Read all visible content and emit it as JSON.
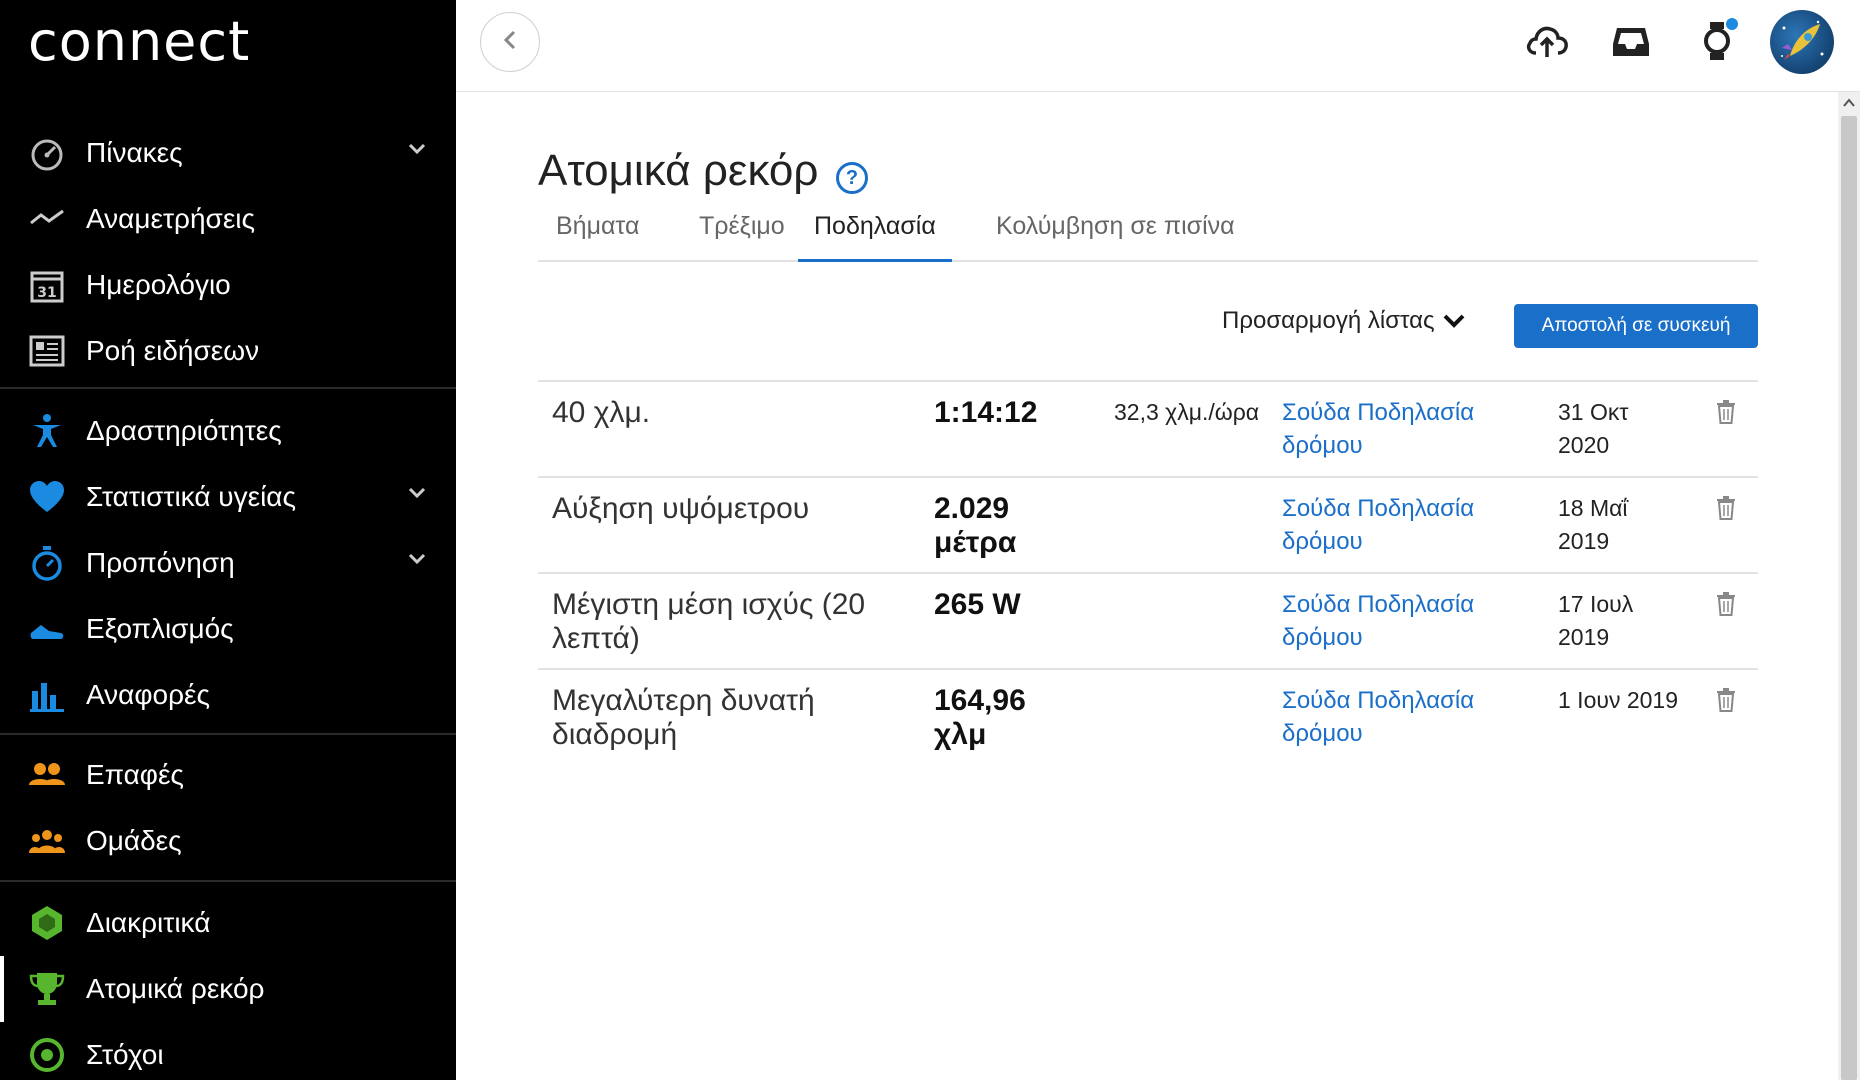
{
  "app": {
    "logo": "connect"
  },
  "sidebar": {
    "items": [
      {
        "label": "Πίνακες",
        "icon": "dashboard-gauge-icon",
        "has_chevron": true
      },
      {
        "label": "Αναμετρήσεις",
        "icon": "trend-icon",
        "has_chevron": false
      },
      {
        "label": "Ημερολόγιο",
        "icon": "calendar-icon",
        "calendar_day": "31",
        "has_chevron": false
      },
      {
        "label": "Ροή ειδήσεων",
        "icon": "newsfeed-icon",
        "has_chevron": false
      },
      {
        "label": "Δραστηριότητες",
        "icon": "activity-person-icon",
        "has_chevron": false
      },
      {
        "label": "Στατιστικά υγείας",
        "icon": "heart-icon",
        "has_chevron": true
      },
      {
        "label": "Προπόνηση",
        "icon": "stopwatch-icon",
        "has_chevron": true
      },
      {
        "label": "Εξοπλισμός",
        "icon": "shoe-icon",
        "has_chevron": false
      },
      {
        "label": "Αναφορές",
        "icon": "bar-chart-icon",
        "has_chevron": false
      },
      {
        "label": "Επαφές",
        "icon": "contacts-icon",
        "has_chevron": false
      },
      {
        "label": "Ομάδες",
        "icon": "groups-icon",
        "has_chevron": false
      },
      {
        "label": "Διακριτικά",
        "icon": "badge-hexagon-icon",
        "has_chevron": false
      },
      {
        "label": "Ατομικά ρεκόρ",
        "icon": "trophy-icon",
        "has_chevron": false,
        "active": true
      },
      {
        "label": "Στόχοι",
        "icon": "target-icon",
        "has_chevron": false
      }
    ]
  },
  "header": {
    "icons": [
      "upload-cloud-icon",
      "inbox-icon",
      "watch-icon",
      "avatar"
    ]
  },
  "page": {
    "title": "Ατομικά ρεκόρ",
    "help": "?",
    "tabs": [
      {
        "label": "Βήματα"
      },
      {
        "label": "Τρέξιμο"
      },
      {
        "label": "Ποδηλασία",
        "active": true
      },
      {
        "label": "Κολύμβηση σε πισίνα"
      }
    ],
    "customize_label": "Προσαρμογή λίστας",
    "send_button": "Αποστολή σε συσκευή"
  },
  "records": [
    {
      "name": "40 χλμ.",
      "value": "1:14:12",
      "speed": "32,3 χλμ./ώρα",
      "activity": "Σούδα Ποδηλασία δρόμου",
      "date": "31 Οκτ 2020"
    },
    {
      "name": "Αύξηση υψόμετρου",
      "value": "2.029 μέτρα",
      "speed": "",
      "activity": "Σούδα Ποδηλασία δρόμου",
      "date": "18 Μαΐ 2019"
    },
    {
      "name": "Μέγιστη μέση ισχύς (20 λεπτά)",
      "value": "265 W",
      "speed": "",
      "activity": "Σούδα Ποδηλασία δρόμου",
      "date": "17 Ιουλ 2019"
    },
    {
      "name": "Μεγαλύτερη δυνατή διαδρομή",
      "value": "164,96 χλμ",
      "speed": "",
      "activity": "Σούδα Ποδηλασία δρόμου",
      "date": "1 Ιουν 2019"
    }
  ],
  "colors": {
    "accent": "#1a6fc9",
    "sidebar_bg": "#000000",
    "icon_blue": "#1a8be0",
    "icon_orange": "#f0951b",
    "icon_green": "#57b52e"
  }
}
